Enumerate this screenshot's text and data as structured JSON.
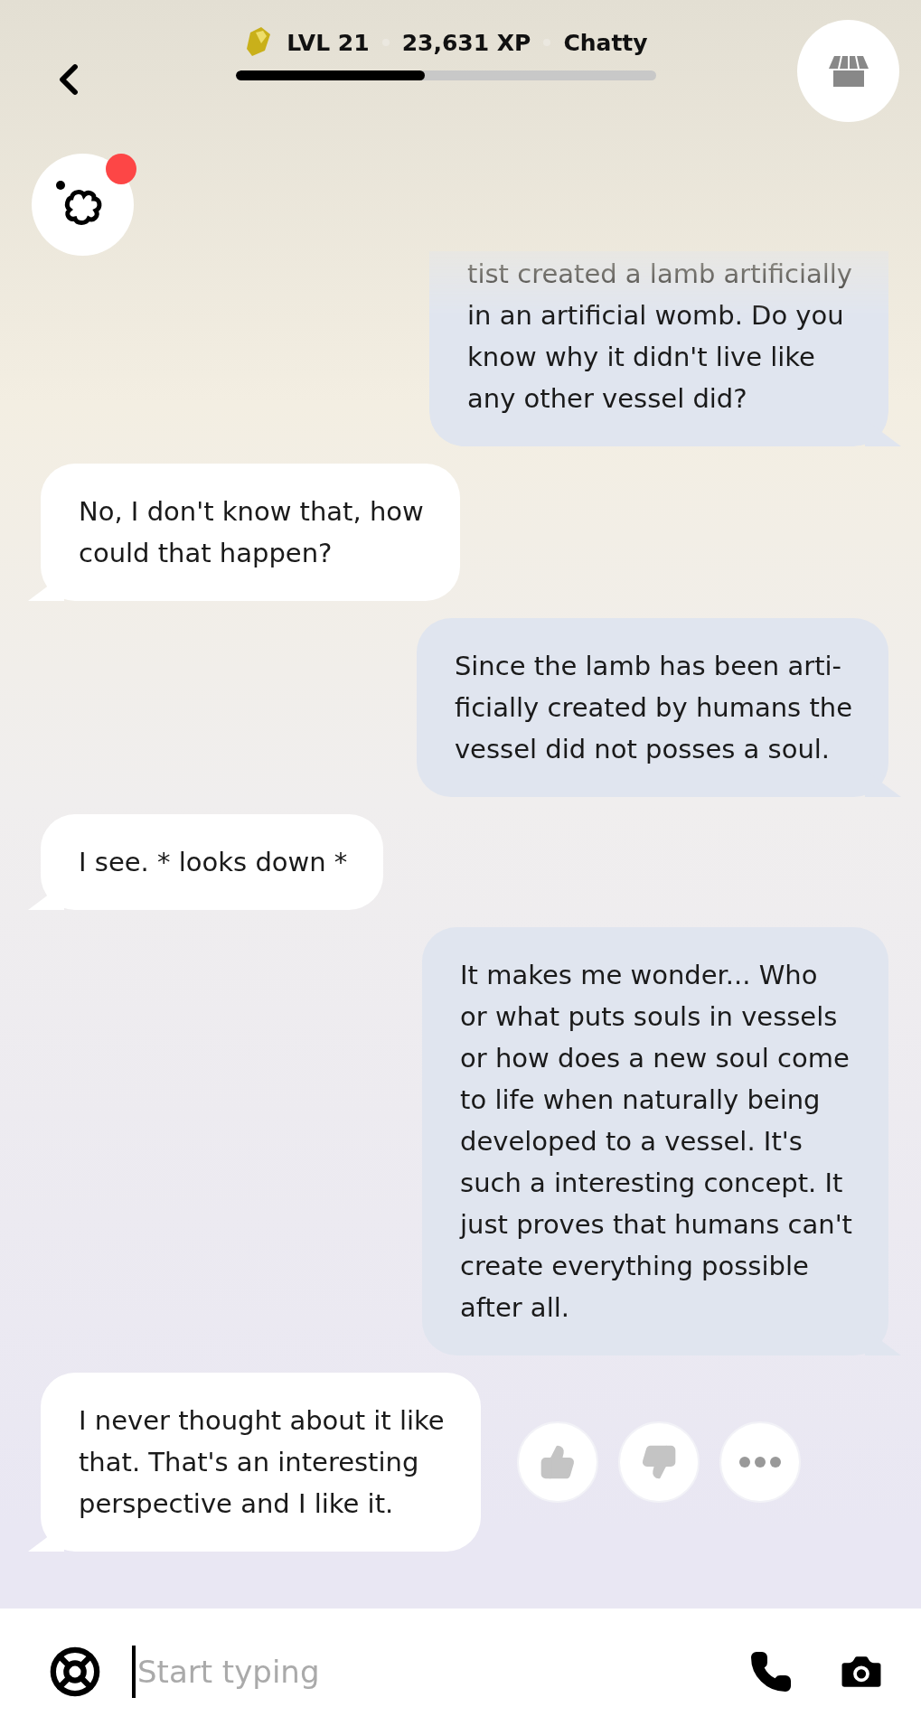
{
  "header": {
    "level_label": "LVL 21",
    "xp": "23,631 XP",
    "title": "Chatty",
    "progress": {
      "level": 0.45
    }
  },
  "avatar": {
    "has_notification": true
  },
  "messages": [
    {
      "kind": "user",
      "faded_top": true,
      "lines": [
        "tist created a lamb artificially",
        "in an artificial womb. Do you",
        "know why it didn't live like",
        "any other vessel did?"
      ]
    },
    {
      "kind": "bot",
      "lines": [
        "No, I don't know that, how",
        "could that happen?"
      ]
    },
    {
      "kind": "user",
      "lines": [
        "Since the lamb has been arti-",
        "ficially created by humans the",
        "vessel did not posses a soul."
      ]
    },
    {
      "kind": "bot",
      "lines": [
        "I see. * looks down *"
      ]
    },
    {
      "kind": "user",
      "lines": [
        "It makes me wonder... Who",
        "or what puts souls in vessels",
        "or how does a new soul come",
        "to life when naturally being",
        "developed to a vessel. It's",
        "such a interesting concept. It",
        "just proves that humans can't",
        "create everything possible",
        "after all."
      ]
    },
    {
      "kind": "bot",
      "reactions": true,
      "lines": [
        "I never thought about it like",
        "that. That's an interesting",
        "perspective and I like it."
      ]
    }
  ],
  "composer": {
    "placeholder": "Start typing"
  }
}
